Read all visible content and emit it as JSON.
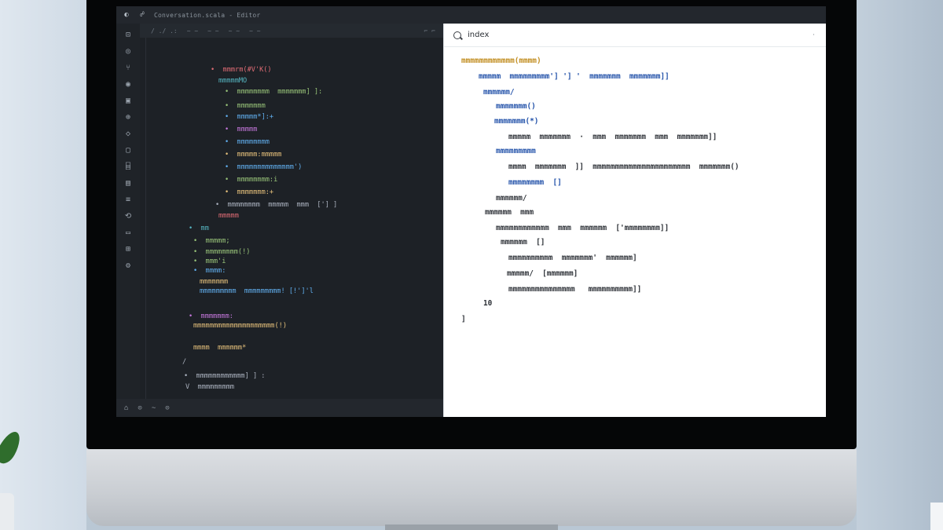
{
  "titlebar": {
    "title": "Conversation.scala - Editor",
    "icons": [
      "app-logo-icon",
      "account-icon"
    ]
  },
  "activity_bar": {
    "icons": [
      "files-icon",
      "search-icon",
      "source-control-icon",
      "debug-icon",
      "extensions-icon",
      "remote-icon",
      "testing-icon",
      "docker-icon",
      "database-icon",
      "timeline-icon",
      "outline-icon",
      "settings-sync-icon",
      "terminal-icon",
      "layout-icon",
      "gear-icon"
    ]
  },
  "editor": {
    "tabs": [
      "/ ./ .:",
      "~ ~",
      "~ ~",
      "~ ~",
      "~ ~"
    ],
    "code_lines": [
      {
        "text": "•  mmmrm(#V'K()",
        "color": "#e06c75"
      },
      {
        "text": "mmmmmMO",
        "color": "#56b6c2"
      },
      {
        "text": "•  mmmmmmmm  mmmmmmm] ]:",
        "color": "#98c379"
      },
      {
        "text": "•  mmmmmmm",
        "color": "#98c379"
      },
      {
        "text": "•  mmmmm*]:+",
        "color": "#61afef"
      },
      {
        "text": "•  mmmmm",
        "color": "#c678dd"
      },
      {
        "text": "•  mmmmmmmm",
        "color": "#61afef"
      },
      {
        "text": "•  mmmmm:mmmmm",
        "color": "#e5c07b"
      },
      {
        "text": "•  mmmmmmmmmmmmmm')",
        "color": "#61afef"
      },
      {
        "text": "•  mmmmmmmm:i",
        "color": "#98c379"
      },
      {
        "text": "•  mmmmmmm:+",
        "color": "#e5c07b"
      },
      {
        "text": "•  mmmmmmmm  mmmmm  mmm  ['] ]",
        "color": "#abb2bf"
      },
      {
        "text": "mmmmm",
        "color": "#e06c75"
      },
      {
        "text": "•  mm",
        "color": "#56b6c2"
      },
      {
        "text": "•  mmmmm;",
        "color": "#98c379"
      },
      {
        "text": "•  mmmmmmmm(!)",
        "color": "#98c379"
      },
      {
        "text": "•  mmm'i",
        "color": "#98c379"
      },
      {
        "text": "•  mmmm:",
        "color": "#61afef"
      },
      {
        "text": "mmmmmmm",
        "color": "#e5c07b"
      },
      {
        "text": "mmmmmmmmm  mmmmmmmmm! [!']'l",
        "color": "#61afef"
      },
      {
        "text": "•  mmmmmmm:",
        "color": "#c678dd"
      },
      {
        "text": "mmmmmmmmmmmmmmmmmmmm(!)",
        "color": "#e5c07b"
      },
      {
        "text": "mmmm  mmmmmm*",
        "color": "#e5c07b"
      },
      {
        "text": "/",
        "color": "#abb2bf"
      },
      {
        "text": "•  mmmmmmmmmmmm] ] :",
        "color": "#abb2bf"
      },
      {
        "text": "V  mmmmmmmmm",
        "color": "#abb2bf"
      },
      {
        "text": "V  mmmmmmm*",
        "color": "#abb2bf"
      }
    ]
  },
  "statusbar": {
    "items": [
      "⌂",
      "⊙",
      "~",
      "⊙"
    ]
  },
  "preview": {
    "title": "index",
    "code_lines": [
      {
        "text": "mmmmmmmmmmmm(mmmm)",
        "color": "#c08b1c"
      },
      {
        "text": "mmmmm  mmmmmmmmm'] '] '  mmmmmmm  mmmmmmm]]",
        "color": "#1f4fa8"
      },
      {
        "text": "mmmmmm/",
        "color": "#1f4fa8"
      },
      {
        "text": "mmmmmmm()",
        "color": "#1f4fa8"
      },
      {
        "text": "mmmmmmm(*)",
        "color": "#1f4fa8"
      },
      {
        "text": "mmmmm  mmmmmmm  ·  mmm  mmmmmmm  mmm  mmmmmmm]]",
        "color": "#2b2f35"
      },
      {
        "text": "mmmmmmmmm",
        "color": "#1f4fa8"
      },
      {
        "text": "mmmm  mmmmmmm  ]]  mmmmmmmmmmmmmmmmmmmmmm  mmmmmmm()",
        "color": "#2b2f35"
      },
      {
        "text": "mmmmmmmm  []",
        "color": "#1f4fa8"
      },
      {
        "text": "mmmmmm/",
        "color": "#2b2f35"
      },
      {
        "text": "mmmmmm  mmm",
        "color": "#2b2f35"
      },
      {
        "text": "mmmmmmmmmmmm  mmm  mmmmmm  ['mmmmmmmm]]",
        "color": "#2b2f35"
      },
      {
        "text": "mmmmmm  []",
        "color": "#2b2f35"
      },
      {
        "text": "mmmmmmmmmm  mmmmmmm'  mmmmmm]",
        "color": "#2b2f35"
      },
      {
        "text": "mmmmm/  [mmmmmm]",
        "color": "#2b2f35"
      },
      {
        "text": "mmmmmmmmmmmmmmm   mmmmmmmmmm]]",
        "color": "#2b2f35"
      },
      {
        "text": "10",
        "color": "#2b2f35"
      },
      {
        "text": "]",
        "color": "#2b2f35"
      }
    ]
  },
  "colors": {
    "editor_bg": "#1d2126",
    "preview_bg": "#ffffff",
    "monitor_bezel": "#050607"
  }
}
